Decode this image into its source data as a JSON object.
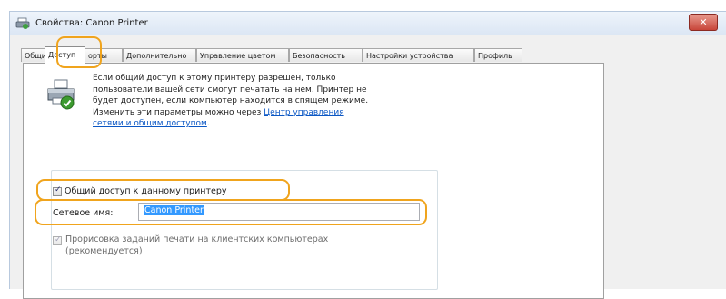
{
  "window": {
    "title": "Свойства: Canon Printer",
    "close_glyph": "✕"
  },
  "tabs": [
    {
      "label": "Общи"
    },
    {
      "label": "Доступ",
      "active": true
    },
    {
      "label": "орты"
    },
    {
      "label": "Дополнительно"
    },
    {
      "label": "Управление цветом"
    },
    {
      "label": "Безопасность"
    },
    {
      "label": "Настройки устройства"
    },
    {
      "label": "Профиль"
    }
  ],
  "sharing": {
    "description_lines": [
      "Если общий доступ к этому принтеру разрешен, только",
      "пользователи вашей сети смогут печатать на нем. Принтер не",
      "будет доступен, если компьютер находится в спящем режиме.",
      "Изменить эти параметры можно через"
    ],
    "link_part1": "Центр управления",
    "link_part2": "сетями и общим доступом",
    "link_suffix": ".",
    "share_checkbox_label": "Общий доступ к данному принтеру",
    "share_checked": true,
    "network_name_label": "Сетевое имя:",
    "network_name_value": "Canon Printer",
    "render_jobs_label": "Прорисовка заданий печати на клиентских компьютерах",
    "render_jobs_sublabel": "(рекомендуется)",
    "render_jobs_checked": true,
    "render_jobs_enabled": false
  },
  "colors": {
    "highlight": "#f0a41d",
    "link": "#0b57c4",
    "selection": "#3399ff"
  },
  "icons": {
    "title": "printer-icon",
    "close": "close-icon",
    "printer": "shared-printer-icon",
    "check": "checkmark-icon"
  }
}
